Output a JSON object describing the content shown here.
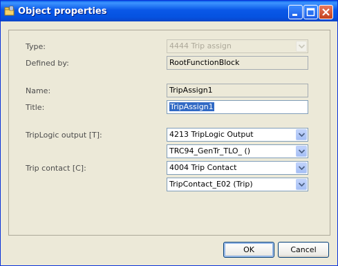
{
  "window": {
    "title": "Object properties",
    "icon": "folder-properties-icon",
    "controls": {
      "minimize": "minimize-icon",
      "maximize": "maximize-icon",
      "close": "close-icon"
    }
  },
  "form": {
    "type": {
      "label": "Type:",
      "value": "4444  Trip assign"
    },
    "defined_by": {
      "label": "Defined by:",
      "value": "RootFunctionBlock"
    },
    "name": {
      "label": "Name:",
      "value": "TripAssign1"
    },
    "title": {
      "label": "Title:",
      "value": "TripAssign1"
    },
    "trip_logic": {
      "label": "TripLogic output [T]:",
      "value1": "4213  TripLogic Output",
      "value2": "TRC94_GenTr_TLO_ ()"
    },
    "trip_contact": {
      "label": "Trip contact [C]:",
      "value1": "4004  Trip Contact",
      "value2": "TripContact_E02 (Trip)"
    }
  },
  "buttons": {
    "ok": "OK",
    "cancel": "Cancel"
  },
  "colors": {
    "titlebar": "#0A58E8",
    "dialog_bg": "#ECE9D8",
    "selection": "#316AC5"
  }
}
